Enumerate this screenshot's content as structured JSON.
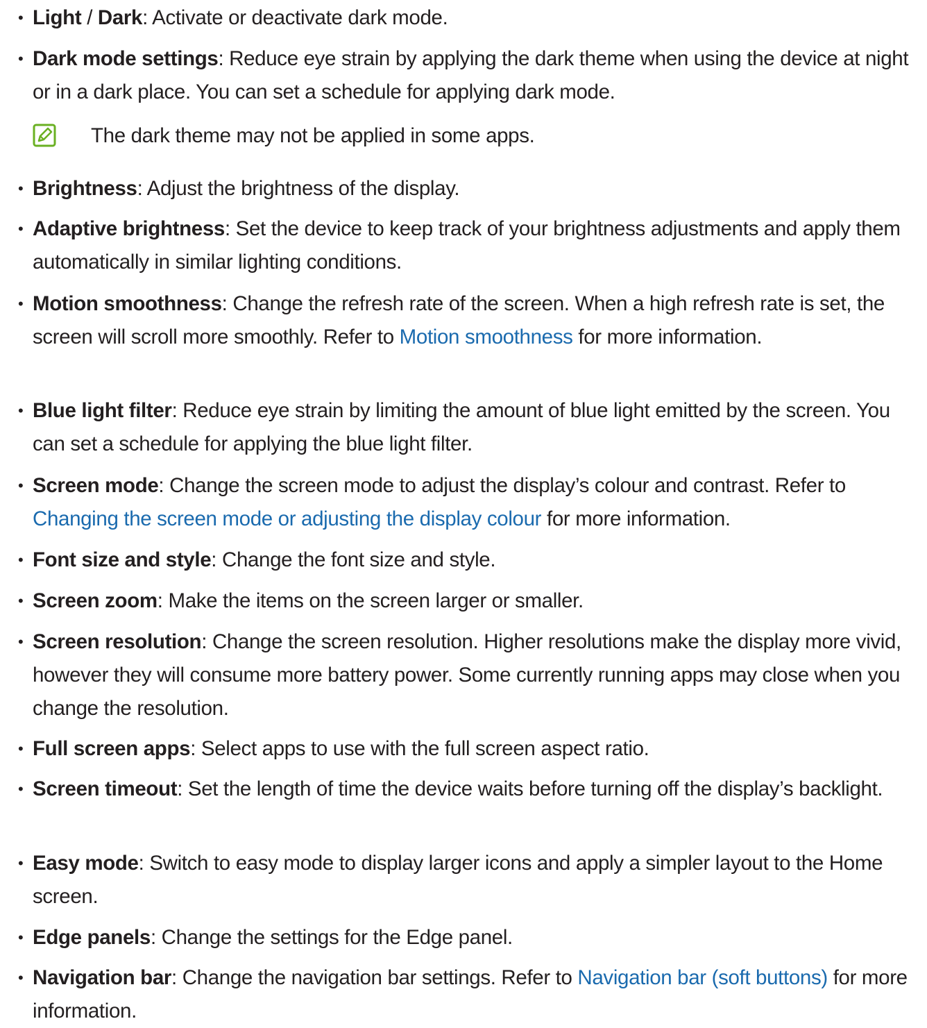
{
  "bullet_glyph": "•",
  "sep": ": ",
  "colors": {
    "text": "#231f20",
    "link": "#1a6aae",
    "note_icon": "#6ab023"
  },
  "items": [
    {
      "term": "Light",
      "term_sep": " / ",
      "term2": "Dark",
      "desc": "Activate or deactivate dark mode."
    },
    {
      "term": "Dark mode settings",
      "desc": "Reduce eye strain by applying the dark theme when using the device at night or in a dark place. You can set a schedule for applying dark mode."
    },
    {
      "term": "Brightness",
      "desc": "Adjust the brightness of the display."
    },
    {
      "term": "Adaptive brightness",
      "desc": "Set the device to keep track of your brightness adjustments and apply them automatically in similar lighting conditions."
    },
    {
      "term": "Motion smoothness",
      "desc_before": "Change the refresh rate of the screen. When a high refresh rate is set, the screen will scroll more smoothly. Refer to ",
      "link": "Motion smoothness",
      "desc_after": " for more information."
    },
    {
      "term": "Blue light filter",
      "desc": "Reduce eye strain by limiting the amount of blue light emitted by the screen. You can set a schedule for applying the blue light filter."
    },
    {
      "term": "Screen mode",
      "desc_before": "Change the screen mode to adjust the display’s colour and contrast. Refer to ",
      "link": "Changing the screen mode or adjusting the display colour",
      "desc_after": " for more information."
    },
    {
      "term": "Font size and style",
      "desc": "Change the font size and style."
    },
    {
      "term": "Screen zoom",
      "desc": "Make the items on the screen larger or smaller."
    },
    {
      "term": "Screen resolution",
      "desc": "Change the screen resolution. Higher resolutions make the display more vivid, however they will consume more battery power. Some currently running apps may close when you change the resolution."
    },
    {
      "term": "Full screen apps",
      "desc": "Select apps to use with the full screen aspect ratio."
    },
    {
      "term": "Screen timeout",
      "desc": "Set the length of time the device waits before turning off the display’s backlight."
    },
    {
      "term": "Easy mode",
      "desc": "Switch to easy mode to display larger icons and apply a simpler layout to the Home screen."
    },
    {
      "term": "Edge panels",
      "desc": "Change the settings for the Edge panel."
    },
    {
      "term": "Navigation bar",
      "desc_before": "Change the navigation bar settings. Refer to ",
      "link": "Navigation bar (soft buttons)",
      "desc_after": " for more information."
    }
  ],
  "note": {
    "icon": "note-pencil-icon",
    "text": "The dark theme may not be applied in some apps."
  }
}
